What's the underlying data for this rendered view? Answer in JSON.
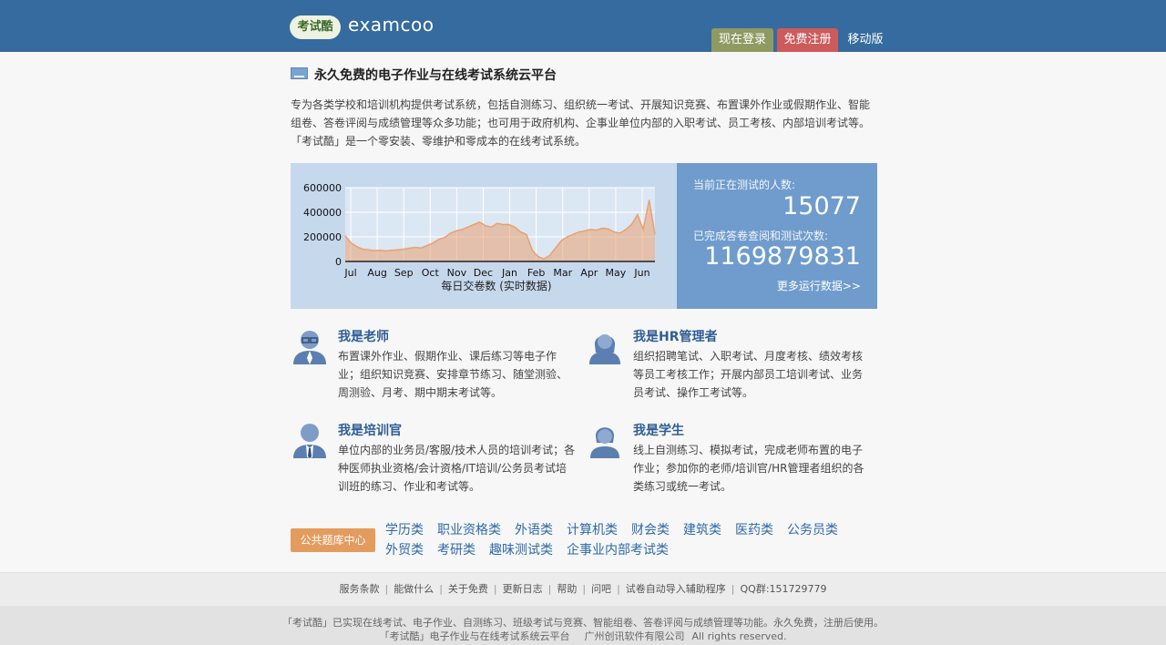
{
  "header": {
    "logo_badge": "考试酷",
    "logo_text": "examcoo",
    "login": "现在登录",
    "register": "免费注册",
    "mobile": "移动版",
    "colors": {
      "bar": "#356b9e",
      "login": "#8f9a63",
      "register": "#cd5b5b"
    }
  },
  "intro": {
    "title": "永久免费的电子作业与在线考试系统云平台",
    "text": "专为各类学校和培训机构提供考试系统，包括自测练习、组织统一考试、开展知识竞赛、布置课外作业或假期作业、智能组卷、答卷评阅与成绩管理等众多功能；也可用于政府机构、企事业单位内部的入职考试、员工考核、内部培训考试等。「考试酷」是一个零安装、零维护和零成本的在线考试系统。"
  },
  "stats": {
    "testing_label": "当前正在测试的人数:",
    "testing_value": "15077",
    "completed_label": "已完成答卷查阅和测试次数:",
    "completed_value": "1169879831",
    "more": "更多运行数据>>"
  },
  "chart_data": {
    "type": "area",
    "caption": "每日交卷数 (实时数据)",
    "x_ticks": [
      "Jul",
      "Aug",
      "Sep",
      "Oct",
      "Nov",
      "Dec",
      "Jan",
      "Feb",
      "Mar",
      "Apr",
      "May",
      "Jun"
    ],
    "y_ticks": [
      "600000",
      "400000",
      "200000",
      "0"
    ],
    "ylim": [
      0,
      600000
    ],
    "grid": true,
    "series": [
      {
        "color": "#e8a070",
        "values": [
          210000,
          150000,
          120000,
          100000,
          95000,
          88000,
          92000,
          85000,
          90000,
          95000,
          100000,
          108000,
          115000,
          110000,
          130000,
          150000,
          180000,
          195000,
          230000,
          250000,
          260000,
          280000,
          300000,
          320000,
          290000,
          280000,
          310000,
          300000,
          300000,
          280000,
          240000,
          220000,
          90000,
          40000,
          20000,
          50000,
          110000,
          170000,
          200000,
          220000,
          240000,
          250000,
          260000,
          255000,
          270000,
          265000,
          240000,
          230000,
          260000,
          300000,
          380000,
          260000,
          500000,
          220000
        ]
      }
    ]
  },
  "roles": [
    {
      "title": "我是老师",
      "desc": "布置课外作业、假期作业、课后练习等电子作业；组织知识竞赛、安排章节练习、随堂测验、周测验、月考、期中期末考试等。",
      "icon": "teacher-icon"
    },
    {
      "title": "我是HR管理者",
      "desc": "组织招聘笔试、入职考试、月度考核、绩效考核等员工考核工作；开展内部员工培训考试、业务员考试、操作工考试等。",
      "icon": "hr-manager-icon"
    },
    {
      "title": "我是培训官",
      "desc": "单位内部的业务员/客服/技术人员的培训考试；各种医师执业资格/会计资格/IT培训/公务员考试培训班的练习、作业和考试等。",
      "icon": "trainer-icon"
    },
    {
      "title": "我是学生",
      "desc": "线上自测练习、模拟考试，完成老师布置的电子作业；参加你的老师/培训官/HR管理者组织的各类练习或统一考试。",
      "icon": "student-icon"
    }
  ],
  "bank": {
    "button": "公共题库中心",
    "links": [
      "学历类",
      "职业资格类",
      "外语类",
      "计算机类",
      "财会类",
      "建筑类",
      "医药类",
      "公务员类",
      "外贸类",
      "考研类",
      "趣味测试类",
      "企事业内部考试类"
    ]
  },
  "footer": {
    "links": [
      "服务条款",
      "能做什么",
      "关于免费",
      "更新日志",
      "帮助",
      "问吧",
      "试卷自动导入辅助程序"
    ],
    "qq": "QQ群:151729779",
    "line1": "「考试酷」已实现在线考试、电子作业、自测练习、班级考试与竞赛、智能组卷、答卷评阅与成绩管理等功能。永久免费，注册后使用。",
    "line2_left": "「考试酷」电子作业与在线考试系统云平台",
    "line2_company": "广州创讯软件有限公司",
    "line2_rights": "All rights reserved."
  }
}
